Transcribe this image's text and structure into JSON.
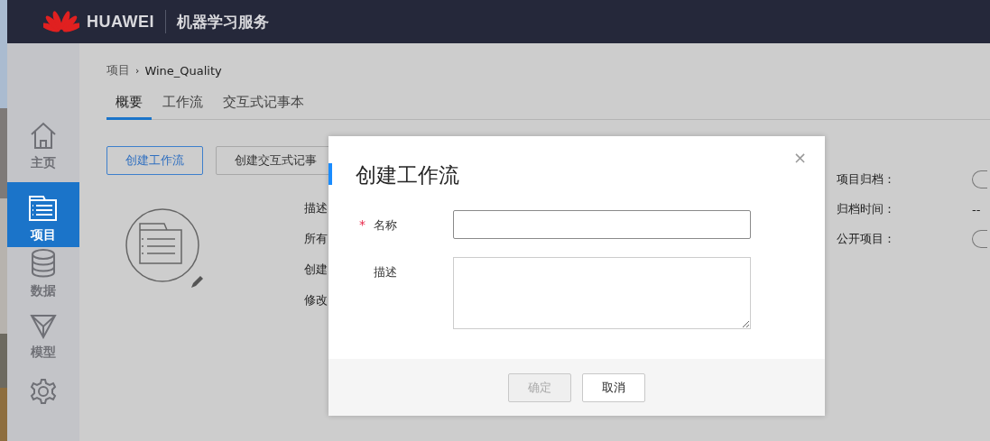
{
  "header": {
    "brand": "HUAWEI",
    "title": "机器学习服务"
  },
  "sidebar": {
    "items": [
      {
        "label": "主页",
        "selected": false
      },
      {
        "label": "项目",
        "selected": true
      },
      {
        "label": "数据",
        "selected": false
      },
      {
        "label": "模型",
        "selected": false
      },
      {
        "selected": false
      }
    ]
  },
  "breadcrumb": [
    "项目",
    "›",
    "Wine_Quality"
  ],
  "tabs": [
    {
      "label": "概要",
      "selected": true
    },
    {
      "label": "工作流",
      "selected": false
    },
    {
      "label": "交互式记事本",
      "selected": false
    }
  ],
  "actions": [
    {
      "label": "创建工作流",
      "kind": "primary"
    },
    {
      "label": "创建交互式记事",
      "kind": "default"
    }
  ],
  "info_labels": [
    "描述",
    "所有",
    "创建",
    "修改"
  ],
  "settings": [
    {
      "label": "项目归档：",
      "kind": "toggle",
      "on": false
    },
    {
      "label": "归档时间：",
      "kind": "text",
      "value": "--"
    },
    {
      "label": "公开项目：",
      "kind": "toggle",
      "on": false
    }
  ],
  "dialog": {
    "title": "创建工作流",
    "close": "×",
    "fields": [
      {
        "label": "名称",
        "required_mark": "*",
        "kind": "input"
      },
      {
        "label": "描述",
        "kind": "textarea"
      }
    ],
    "buttons": [
      {
        "label": "确定",
        "disabled": true
      },
      {
        "label": "取消",
        "disabled": false
      }
    ]
  }
}
